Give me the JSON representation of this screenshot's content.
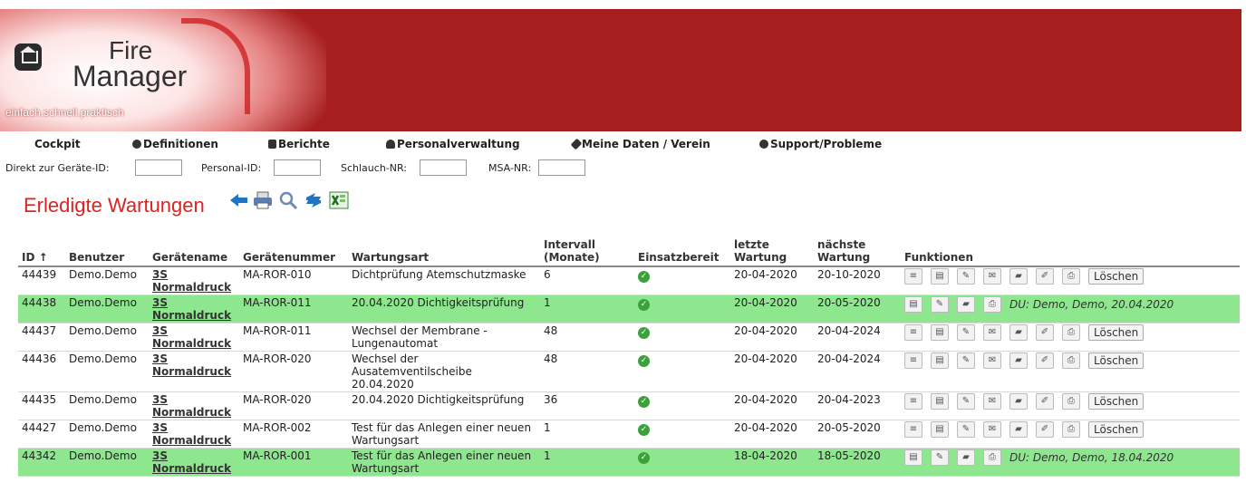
{
  "logo": {
    "fire": "Fire",
    "manager": "Manager",
    "tagline": "einfach.schnell.praktisch"
  },
  "nav": [
    {
      "label": "Cockpit",
      "icon": ""
    },
    {
      "label": "Definitionen",
      "icon": "gear-icon"
    },
    {
      "label": "Berichte",
      "icon": "sliders-icon"
    },
    {
      "label": "Personalverwaltung",
      "icon": "user-icon"
    },
    {
      "label": "Meine Daten / Verein",
      "icon": "wrench-icon"
    },
    {
      "label": "Support/Probleme",
      "icon": "support-icon"
    }
  ],
  "quick": {
    "device_label": "Direkt zur Geräte-ID:",
    "person_label": "Personal-ID:",
    "hose_label": "Schlauch-NR:",
    "msa_label": "MSA-NR:"
  },
  "page_title": "Erledigte Wartungen",
  "toolbar_icons": [
    "back-arrow-icon",
    "print-icon",
    "search-icon",
    "refresh-icon",
    "excel-icon"
  ],
  "columns": {
    "id": "ID ↑",
    "user": "Benutzer",
    "device_name": "Gerätename",
    "device_number": "Gerätenummer",
    "type": "Wartungsart",
    "interval": "Intervall (Monate)",
    "ready": "Einsatzbereit",
    "last": "letzte Wartung",
    "next": "nächste Wartung",
    "functions": "Funktionen"
  },
  "delete_label": "Löschen",
  "rows": [
    {
      "id": "44439",
      "user": "Demo.Demo",
      "device_name": "3S Normaldruck",
      "device_number": "MA-ROR-010",
      "type": "Dichtprüfung Atemschutzmaske",
      "interval": "6",
      "last": "20-04-2020",
      "next": "20-10-2020",
      "done": false,
      "note": ""
    },
    {
      "id": "44438",
      "user": "Demo.Demo",
      "device_name": "3S Normaldruck",
      "device_number": "MA-ROR-011",
      "type": "20.04.2020 Dichtigkeitsprüfung",
      "interval": "1",
      "last": "20-04-2020",
      "next": "20-05-2020",
      "done": true,
      "note": "DU: Demo, Demo, 20.04.2020"
    },
    {
      "id": "44437",
      "user": "Demo.Demo",
      "device_name": "3S Normaldruck",
      "device_number": "MA-ROR-011",
      "type": "Wechsel der Membrane - Lungenautomat",
      "interval": "48",
      "last": "20-04-2020",
      "next": "20-04-2024",
      "done": false,
      "note": ""
    },
    {
      "id": "44436",
      "user": "Demo.Demo",
      "device_name": "3S Normaldruck",
      "device_number": "MA-ROR-020",
      "type": "Wechsel der Ausatemventilscheibe 20.04.2020",
      "interval": "48",
      "last": "20-04-2020",
      "next": "20-04-2024",
      "done": false,
      "note": ""
    },
    {
      "id": "44435",
      "user": "Demo.Demo",
      "device_name": "3S Normaldruck",
      "device_number": "MA-ROR-020",
      "type": "20.04.2020 Dichtigkeitsprüfung",
      "interval": "36",
      "last": "20-04-2020",
      "next": "20-04-2023",
      "done": false,
      "note": ""
    },
    {
      "id": "44427",
      "user": "Demo.Demo",
      "device_name": "3S Normaldruck",
      "device_number": "MA-ROR-002",
      "type": "Test für das Anlegen einer neuen Wartungsart",
      "interval": "1",
      "last": "20-04-2020",
      "next": "20-05-2020",
      "done": false,
      "note": ""
    },
    {
      "id": "44342",
      "user": "Demo.Demo",
      "device_name": "3S Normaldruck",
      "device_number": "MA-ROR-001",
      "type": "Test für das Anlegen einer neuen Wartungsart",
      "interval": "1",
      "last": "18-04-2020",
      "next": "18-05-2020",
      "done": true,
      "note": "DU: Demo, Demo, 18.04.2020"
    }
  ]
}
